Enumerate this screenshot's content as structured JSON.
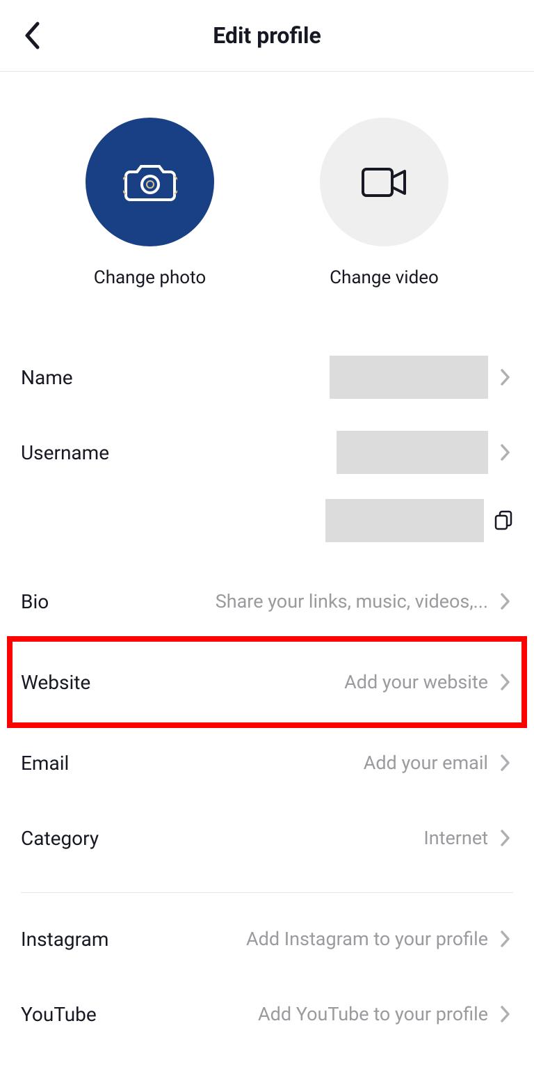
{
  "header": {
    "title": "Edit profile"
  },
  "media": {
    "photo_label": "Change photo",
    "video_label": "Change video"
  },
  "rows": {
    "name": {
      "label": "Name"
    },
    "username": {
      "label": "Username"
    },
    "bio": {
      "label": "Bio",
      "placeholder": "Share your links, music, videos,..."
    },
    "website": {
      "label": "Website",
      "placeholder": "Add your website"
    },
    "email": {
      "label": "Email",
      "placeholder": "Add your email"
    },
    "category": {
      "label": "Category",
      "value": "Internet"
    },
    "instagram": {
      "label": "Instagram",
      "placeholder": "Add Instagram to your profile"
    },
    "youtube": {
      "label": "YouTube",
      "placeholder": "Add YouTube to your profile"
    }
  },
  "colors": {
    "highlight": "#fd0100",
    "photo_bg": "#194084",
    "video_bg": "#efefef"
  }
}
